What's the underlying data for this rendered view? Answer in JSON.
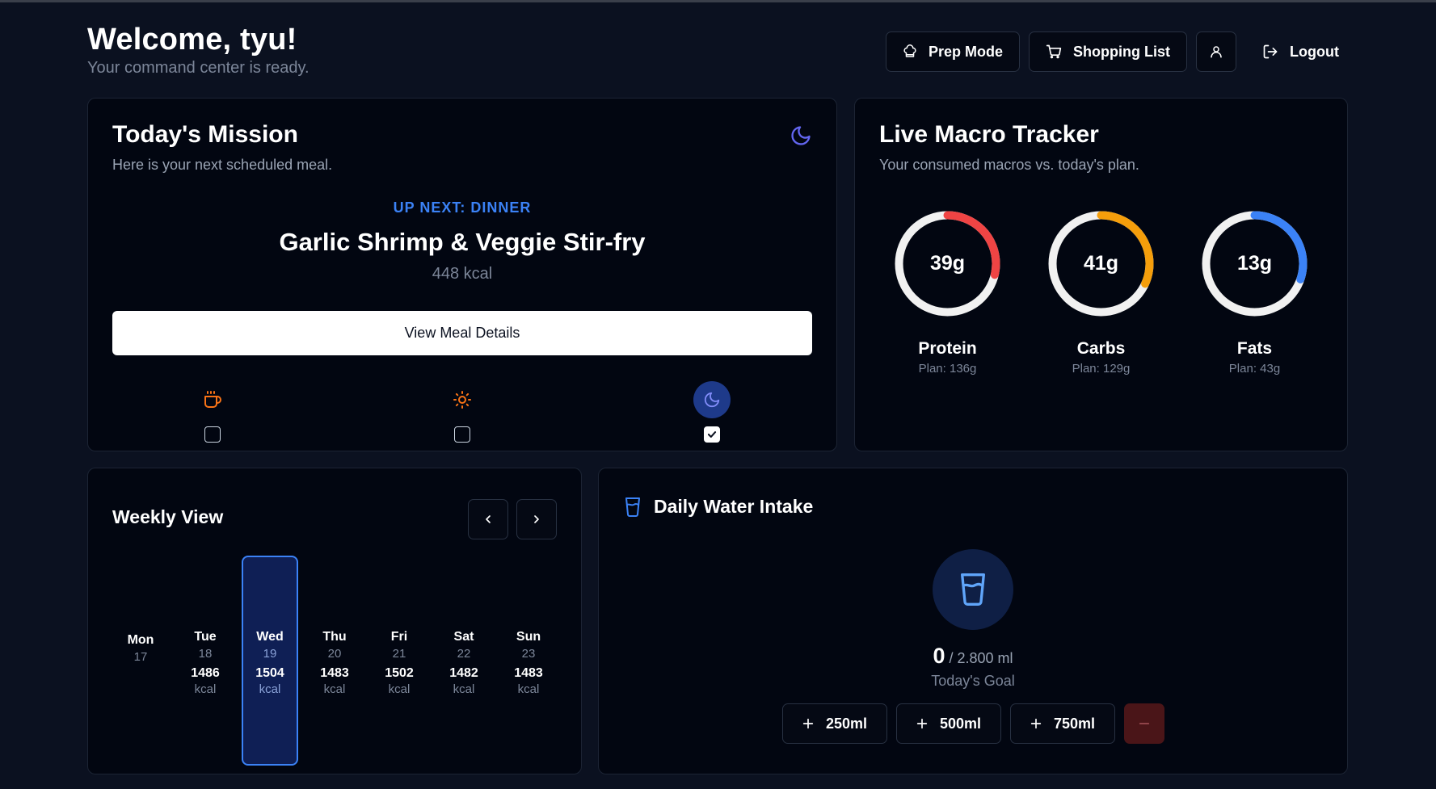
{
  "header": {
    "welcome": "Welcome, tyu!",
    "subtitle": "Your command center is ready.",
    "prep_mode": "Prep Mode",
    "shopping_list": "Shopping List",
    "logout": "Logout"
  },
  "mission": {
    "title": "Today's Mission",
    "subtitle": "Here is your next scheduled meal.",
    "up_next": "UP NEXT: DINNER",
    "meal": "Garlic Shrimp & Veggie Stir-fry",
    "kcal": "448 kcal",
    "view_button": "View Meal Details",
    "slots": [
      {
        "name": "breakfast",
        "icon": "coffee-icon",
        "checked": false
      },
      {
        "name": "lunch",
        "icon": "sun-icon",
        "checked": false
      },
      {
        "name": "dinner",
        "icon": "moon-icon",
        "checked": true,
        "active": true
      }
    ]
  },
  "macros": {
    "title": "Live Macro Tracker",
    "subtitle": "Your consumed macros vs. today's plan.",
    "items": [
      {
        "value": "39g",
        "label": "Protein",
        "plan": "Plan: 136g",
        "consumed": 39,
        "planned": 136,
        "color": "#ef4444"
      },
      {
        "value": "41g",
        "label": "Carbs",
        "plan": "Plan: 129g",
        "consumed": 41,
        "planned": 129,
        "color": "#f59e0b"
      },
      {
        "value": "13g",
        "label": "Fats",
        "plan": "Plan: 43g",
        "consumed": 13,
        "planned": 43,
        "color": "#3b82f6"
      }
    ]
  },
  "weekly": {
    "title": "Weekly View",
    "days": [
      {
        "name": "Mon",
        "date": "17",
        "kcal": "",
        "unit": ""
      },
      {
        "name": "Tue",
        "date": "18",
        "kcal": "1486",
        "unit": "kcal"
      },
      {
        "name": "Wed",
        "date": "19",
        "kcal": "1504",
        "unit": "kcal",
        "selected": true
      },
      {
        "name": "Thu",
        "date": "20",
        "kcal": "1483",
        "unit": "kcal"
      },
      {
        "name": "Fri",
        "date": "21",
        "kcal": "1502",
        "unit": "kcal"
      },
      {
        "name": "Sat",
        "date": "22",
        "kcal": "1482",
        "unit": "kcal"
      },
      {
        "name": "Sun",
        "date": "23",
        "kcal": "1483",
        "unit": "kcal"
      }
    ]
  },
  "water": {
    "title": "Daily Water Intake",
    "current": "0",
    "goal_text": "/ 2.800 ml",
    "goal_label": "Today's Goal",
    "add_250": "250ml",
    "add_500": "500ml",
    "add_750": "750ml"
  },
  "colors": {
    "accent": "#3b82f6",
    "moon": "#6366f1",
    "meal_icon": "#f97316",
    "danger_bg": "#4a1518"
  }
}
